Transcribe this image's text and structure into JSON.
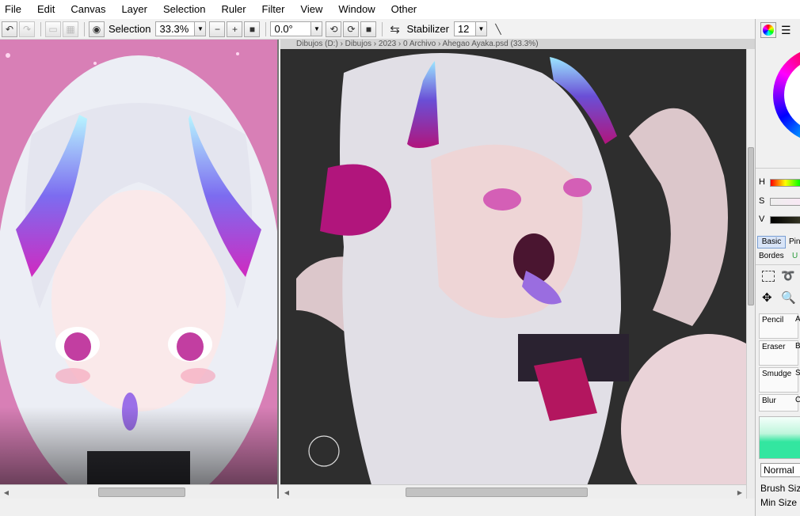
{
  "menu": [
    "File",
    "Edit",
    "Canvas",
    "Layer",
    "Selection",
    "Ruler",
    "Filter",
    "View",
    "Window",
    "Other"
  ],
  "toolbar": {
    "selection_label": "Selection",
    "zoom": "33.3%",
    "rotation": "0.0°",
    "stabilizer_label": "Stabilizer",
    "stabilizer_value": "12"
  },
  "canvas_title": "Dibujos  (D:) › Dibujos › 2023 › 0 Archivo › Ahegao Ayaka.psd (33.3%)",
  "side": {
    "hsv": [
      "H",
      "S",
      "V"
    ],
    "tab_basic": "Basic",
    "tab_pin": "Pin",
    "tab_bordes": "Bordes",
    "tab_u": "U",
    "tools": [
      "Pencil",
      "A",
      "Eraser",
      "B",
      "Smudge",
      "S",
      "Blur",
      "C"
    ],
    "blend_mode": "Normal",
    "brush_size": "Brush Size",
    "min_size": "Min Size"
  },
  "colors": {
    "accent": "#f03c9a",
    "canvas_bg": "#2e2e2e",
    "pink_bg": "#d87fb6",
    "brush_green": "#33e6a0"
  }
}
